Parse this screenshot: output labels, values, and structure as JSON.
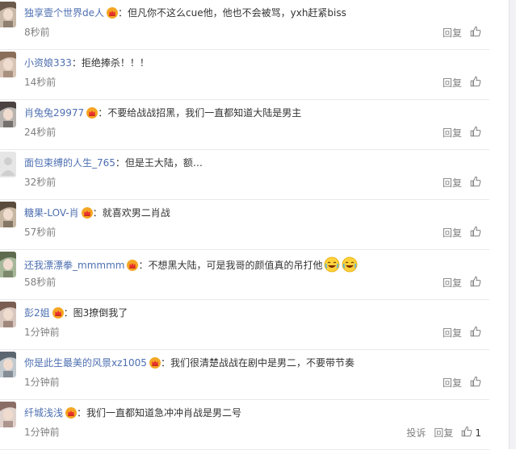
{
  "separator": "：",
  "actions": {
    "reply": "回复",
    "report": "投诉"
  },
  "comments": [
    {
      "user": "独享壹个世界de人",
      "crown": true,
      "text": "但凡你不这么cue他，他也不会被骂，yxh赶紧biss",
      "time": "8秒前",
      "emoji": 0
    },
    {
      "user": "小资娘333",
      "crown": false,
      "text": "拒绝捧杀！！！",
      "time": "14秒前",
      "emoji": 0
    },
    {
      "user": "肖兔兔29977",
      "crown": true,
      "text": "不要给战战招黑，我们一直都知道大陆是男主",
      "time": "24秒前",
      "emoji": 0
    },
    {
      "user": "面包束缚的人生_765",
      "crown": false,
      "text": "但是王大陆，额…",
      "time": "32秒前",
      "emoji": 0
    },
    {
      "user": "糖果-LOV-肖",
      "crown": true,
      "text": "就喜欢男二肖战",
      "time": "57秒前",
      "emoji": 0
    },
    {
      "user": "还我漂漂拳_mmmmm",
      "crown": true,
      "text": "不想黑大陆，可是我哥的颜值真的吊打他",
      "time": "58秒前",
      "emoji": 2
    },
    {
      "user": "彭2姐",
      "crown": true,
      "text": "图3撩倒我了",
      "time": "1分钟前",
      "emoji": 0
    },
    {
      "user": "你是此生最美的风景xz1005",
      "crown": true,
      "text": "我们很清楚战战在剧中是男二，不要带节奏",
      "time": "1分钟前",
      "emoji": 0
    },
    {
      "user": "纤城浅浅",
      "crown": true,
      "text": "我们一直都知道急冲冲肖战是男二号",
      "time": "1分钟前",
      "emoji": 0,
      "like_count": "1",
      "report": true
    }
  ],
  "colors": {
    "username": "#eb7350",
    "meta": "#808080",
    "text": "#333333",
    "divider": "#eaeaea"
  },
  "icons": {
    "crown": "crown-badge-icon",
    "like": "thumbs-up-icon",
    "emoji": "laughing-tears-emoji-icon"
  }
}
